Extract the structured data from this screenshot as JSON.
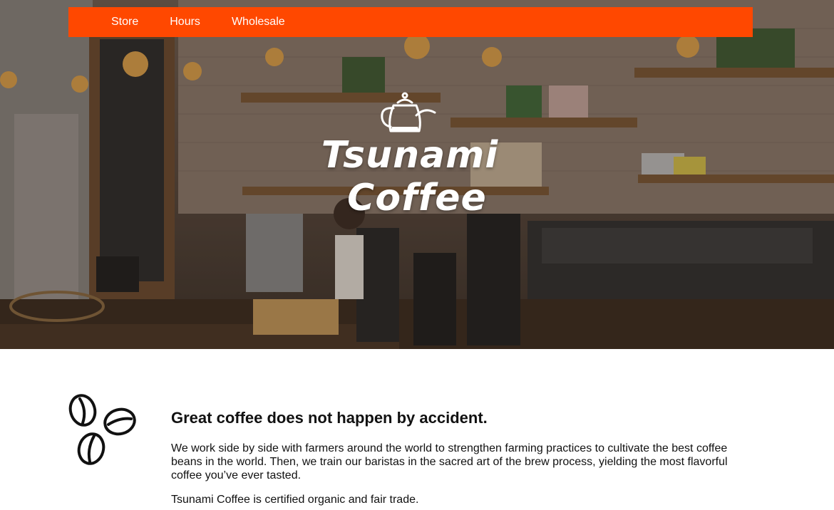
{
  "nav": {
    "items": [
      {
        "label": "Store"
      },
      {
        "label": "Hours"
      },
      {
        "label": "Wholesale"
      }
    ]
  },
  "hero": {
    "logo_line_1": "Tsunami",
    "logo_line_2": "Coffee",
    "logo_icon": "pour-over-kettle-icon",
    "background": "coffee-shop-interior-photo"
  },
  "main": {
    "icon": "coffee-beans-icon",
    "headline": "Great coffee does not happen by accident.",
    "paragraph_1": "We work side by side with farmers around the world to strengthen farming practices to cultivate the best coffee beans in the world. Then, we train our baristas in the sacred art of the brew process, yielding the most flavorful coffee you’ve ever tasted.",
    "paragraph_2": "Tsunami Coffee is certified organic and fair trade."
  },
  "colors": {
    "nav_background": "#ff4800",
    "nav_text": "#ffffff",
    "body_text": "#111111"
  }
}
